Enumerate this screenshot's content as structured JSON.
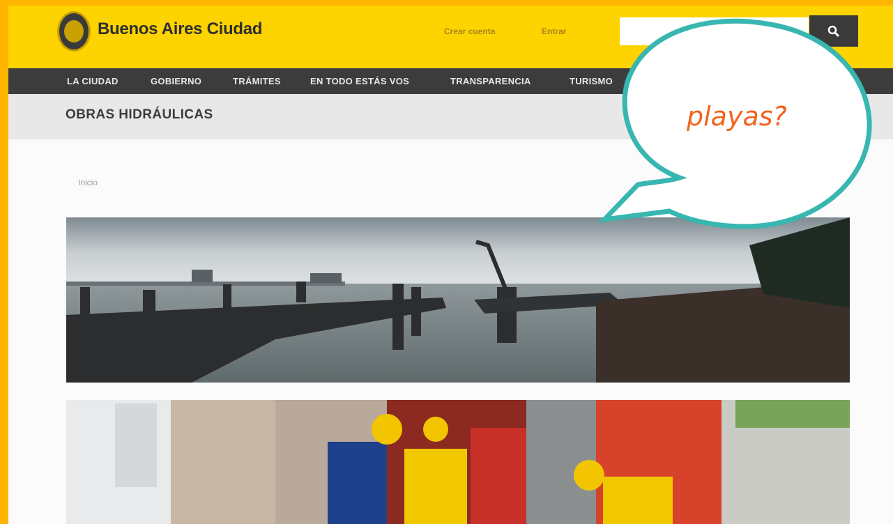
{
  "header": {
    "site_title": "Buenos Aires Ciudad",
    "links": {
      "create_account": "Crear cuenta",
      "login": "Entrar"
    },
    "search": {
      "placeholder": "",
      "button_icon": "search-icon"
    }
  },
  "nav": {
    "items": [
      "LA CIUDAD",
      "GOBIERNO",
      "TRÁMITES",
      "EN TODO ESTÁS VOS",
      "TRANSPARENCIA",
      "TURISMO"
    ]
  },
  "page": {
    "section_title": "OBRAS HIDRÁULICAS",
    "breadcrumb": "Inicio"
  },
  "overlay": {
    "speech_bubble_text": "playas?"
  },
  "colors": {
    "header_yellow": "#fdd300",
    "nav_dark": "#3c3c3c",
    "frame_orange": "#ffb400",
    "bubble_border": "#38b6b0",
    "bubble_text": "#f0641e"
  }
}
